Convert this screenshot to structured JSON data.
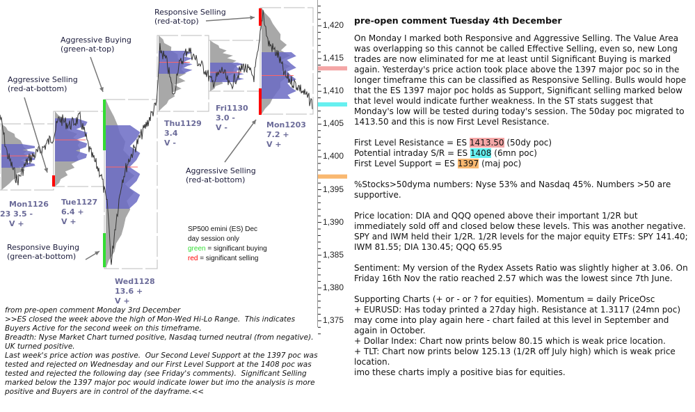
{
  "chart_data": {
    "type": "market-profile",
    "instrument_note": [
      "SP500 emini (ES) Dec",
      "day session only"
    ],
    "legend": [
      {
        "color_word": "green",
        "text": "= significant buying",
        "color": "#33dd33"
      },
      {
        "color_word": "red",
        "text": "= significant selling",
        "color": "#ff0000"
      }
    ],
    "y_axis": {
      "range": [
        1373,
        1424
      ],
      "ticks": [
        "1,420",
        "1,415",
        "1,410",
        "1,405",
        "1,400",
        "1,395",
        "1,390",
        "1,385",
        "1,380",
        "1,375"
      ],
      "tick_values": [
        1420,
        1415,
        1410,
        1405,
        1400,
        1395,
        1390,
        1385,
        1380,
        1375
      ]
    },
    "sessions": [
      {
        "day": "Mon1126",
        "stat": "3.5 -",
        "vol": "V +",
        "prefix": "23"
      },
      {
        "day": "Tue1127",
        "stat": "6.4 +",
        "vol": "V +"
      },
      {
        "day": "Wed1128",
        "stat": "13.6 +",
        "vol": "V +"
      },
      {
        "day": "Thu1129",
        "stat": "3.4",
        "vol": "V -"
      },
      {
        "day": "Fri1130",
        "stat": "3.0 -",
        "vol": "V -"
      },
      {
        "day": "Mon1203",
        "stat": "7.2 +",
        "vol": "V +"
      }
    ],
    "annotations": [
      {
        "text": "Responsive Selling\n(red-at-top)"
      },
      {
        "text": "Aggressive Buying\n(green-at-top)"
      },
      {
        "text": "Aggressive Selling\n(red-at-bottom)"
      },
      {
        "text": "Aggressive Selling\n(red-at-bottom)"
      },
      {
        "text": "Responsive Buying\n(green-at-bottom)"
      }
    ],
    "levels": [
      {
        "value": 1413.5,
        "color": "#f4a6a6"
      },
      {
        "value": 1408,
        "color": "#66f0f0"
      },
      {
        "value": 1397,
        "color": "#f9b870"
      }
    ],
    "colors": {
      "profile_value_area": "#6b6bc4",
      "profile_outer": "#a8a8a8",
      "price": "#333333",
      "poc": "#ff6666"
    }
  },
  "right": {
    "title": "pre-open comment Tuesday 4th December",
    "p1": "On Monday I marked both Responsive and Aggressive Selling.  The Value Area was overlapping so this cannot be called Effective Selling, even so, new Long trades are now eliminated for me at least until Significant Buying is marked again. Yesterday's price action took place above the 1397 major poc so in the longer timeframe this can be classified as Responsive Selling.  Bulls would hope that the ES 1397 major poc holds as Support, Significant selling marked below that level would indicate further weakness.  In the ST stats suggest that Monday's low will be tested during today's session.  The 50day poc migrated to 1413.50 and this is now First Level Resistance.",
    "levels": [
      {
        "prefix": "First Level Resistance = ES ",
        "value": "1413.50",
        "suffix": " (50dy poc)"
      },
      {
        "prefix": "Potential intraday S/R = ES ",
        "value": "1408",
        "suffix": " (6mn poc)"
      },
      {
        "prefix": "First Level Support = ES ",
        "value": "1397",
        "suffix": " (maj poc)"
      }
    ],
    "p2": "%Stocks>50dyma numbers: Nyse 53% and Nasdaq 45%. Numbers >50 are supportive.",
    "p3": "Price location: DIA and QQQ opened above their important 1/2R but immediately sold off and closed below these levels.  This was another negative.  SPY and IWM held their 1/2R.  1/2R levels for the major equity ETFs: SPY 141.40; IWM 81.55; DIA 130.45; QQQ 65.95",
    "p4": "Sentiment: My version of the Rydex Assets Ratio was slightly higher at 3.06. On Friday 16th Nov the ratio reached 2.57 which was the lowest since 7th June.",
    "p5_lines": [
      "Supporting Charts (+ or - or ? for equities).   Momentum = daily PriceOsc",
      "+ EURUSD: Has today printed a 27day high.  Resistance at 1.3117 (24mn poc) may come into play again here - chart failed at this level in September and again in October.",
      "+ Dollar Index: Chart now prints below 80.15 which is weak price location.",
      "+ TLT:  Chart now prints below 125.13 (1/2R off July high) which is weak price location.",
      "imo these charts imply a positive bias for equities."
    ]
  },
  "bottom_left": [
    "from pre-open comment Monday 3rd December",
    ">>ES closed the week above the high of Mon-Wed Hi-Lo Range.  This indicates Buyers Active for the second week on this timeframe.",
    "Breadth: Nyse Market Chart turned positive, Nasdaq turned neutral (from negative).  UK turned positive.",
    "Last week's price action was postive.  Our Second Level Support at the 1397 poc was tested and rejected on Wednesday and our First Level Support at the 1408 poc was tested and rejected the following day (see Friday's comments).  Significant Selling marked below the 1397 major poc would indicate lower but imo the analysis is more positive and Buyers are in control of the dayframe.<<"
  ]
}
